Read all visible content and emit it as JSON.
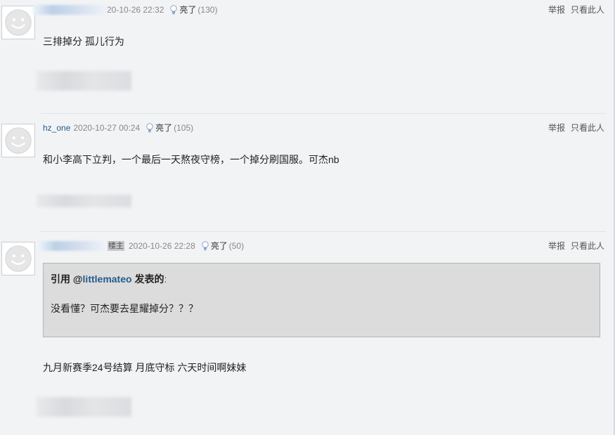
{
  "posts": [
    {
      "username": "",
      "is_op": false,
      "date": "20-10-26 22:32",
      "light_label": "亮了",
      "light_count": "(130)",
      "content": "三排掉分 孤儿行为"
    },
    {
      "username": "hz_one",
      "is_op": false,
      "date": "2020-10-27 00:24",
      "light_label": "亮了",
      "light_count": "(105)",
      "content": "和小李高下立判，一个最后一天熬夜守榜，一个掉分刷国服。可杰nb"
    },
    {
      "username": "",
      "is_op": true,
      "op_badge": "楼主",
      "date": "2020-10-26 22:28",
      "light_label": "亮了",
      "light_count": "(50)",
      "quote": {
        "prefix": "引用 @",
        "user": "littlemateo",
        "suffix": " 发表的",
        "colon": ":",
        "text": "没看懂？可杰要去星耀掉分？？？"
      },
      "content": "九月新赛季24号结算 月底守标 六天时间啊妹妹"
    }
  ],
  "actions": {
    "report": "举报",
    "only_this_user": "只看此人"
  },
  "icons": {
    "avatar": "default-avatar-icon",
    "light": "lightbulb-icon"
  },
  "colors": {
    "username": "#245b8f",
    "meta": "#888888",
    "quote_bg": "#dcdcdc",
    "page_bg": "#f2f3f5"
  }
}
